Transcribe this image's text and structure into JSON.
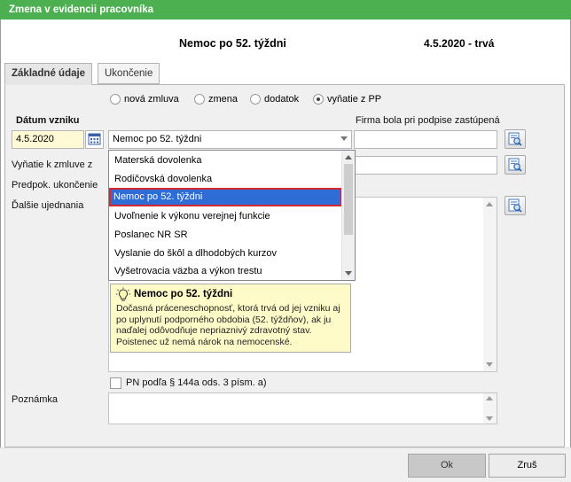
{
  "window": {
    "title": "Zmena v evidencii pracovníka"
  },
  "header": {
    "title": "Nemoc po 52. týždni",
    "date": "4.5.2020 - trvá"
  },
  "tabs": [
    {
      "label": "Základné údaje"
    },
    {
      "label": "Ukončenie"
    }
  ],
  "radios": [
    {
      "label": "nová zmluva",
      "checked": false
    },
    {
      "label": "zmena",
      "checked": false
    },
    {
      "label": "dodatok",
      "checked": false
    },
    {
      "label": "vyňatie z PP",
      "checked": true
    }
  ],
  "form": {
    "datum_label": "Dátum vzniku",
    "datum_value": "4.5.2020",
    "combo_value": "Nemoc po 52. týždni",
    "firma_label": "Firma bola pri podpise zastúpená",
    "vynatie_label": "Vyňatie k zmluve z",
    "predpok_label": "Predpok. ukončenie",
    "dalsie_label": "Ďalšie ujednania",
    "pn_label": "PN podľa § 144a ods. 3 písm. a)",
    "poznamka_label": "Poznámka"
  },
  "dropdown": {
    "items": [
      "Materská dovolenka",
      "Rodičovská dovolenka",
      "Nemoc po 52. týždni",
      "Uvoľnenie k výkonu verejnej funkcie",
      "Poslanec NR SR",
      "Vyslanie do škôl a dlhodobých kurzov",
      "Vyšetrovacia väzba a výkon trestu"
    ],
    "selected_index": 2
  },
  "tooltip": {
    "title": "Nemoc po 52. týždni",
    "text": "Dočasná práceneschopnosť, ktorá trvá od jej vzniku aj po uplynutí podporného obdobia (52. týždňov), ak ju naďalej odôvodňuje nepriaznivý zdravotný stav. Poistenec už nemá nárok na nemocenské."
  },
  "buttons": {
    "ok": "Ok",
    "cancel": "Zruš"
  }
}
